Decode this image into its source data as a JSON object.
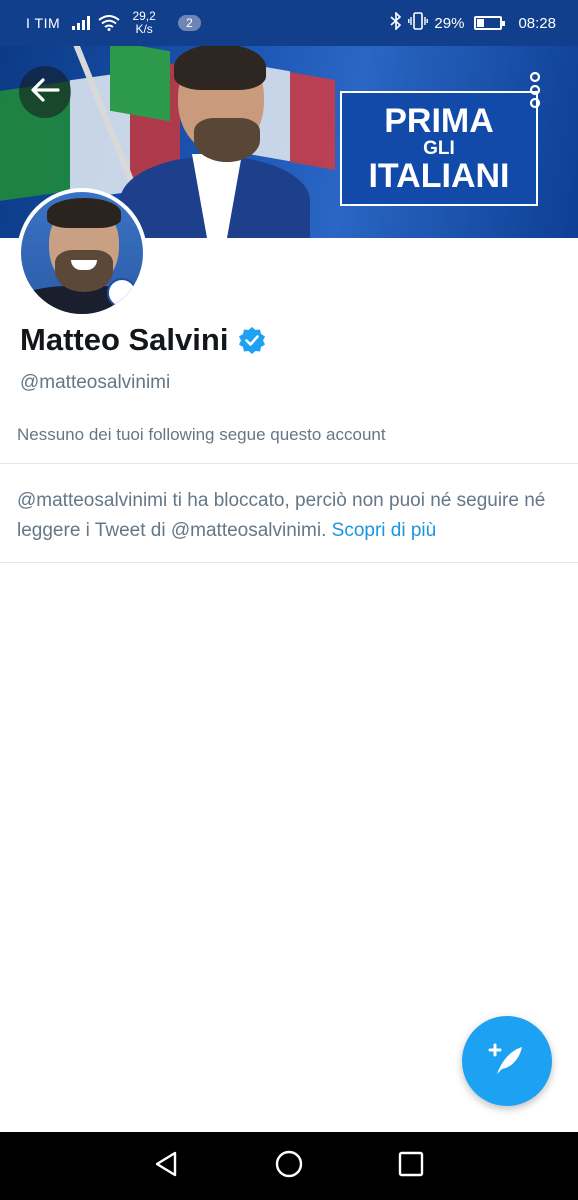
{
  "status_bar": {
    "carrier": "I TIM",
    "speed_value": "29,2",
    "speed_unit": "K/s",
    "notification_count": "2",
    "battery_percent": "29%",
    "battery_level": 0.29,
    "time": "08:28",
    "icons": [
      "signal-icon",
      "wifi-icon",
      "bluetooth-icon",
      "vibrate-icon",
      "battery-icon"
    ]
  },
  "banner": {
    "sign_line1": "PRIMA",
    "sign_line2": "GLI",
    "sign_line3": "ITALIANI",
    "back_icon": "arrow-left-icon",
    "more_icon": "more-vertical-icon"
  },
  "profile": {
    "name": "Matteo Salvini",
    "verified_icon": "verified-badge-icon",
    "handle": "@matteosalvinimi",
    "followers_note": "Nessuno dei tuoi following segue questo account",
    "blocked_text": "@matteosalvinimi ti ha bloccato, perciò non puoi né seguire né leggere i Tweet di @matteosalvinimi.",
    "learn_more": "Scopri di più"
  },
  "fab": {
    "icon": "compose-tweet-icon"
  },
  "nav": {
    "icons": [
      "back-triangle-icon",
      "home-circle-icon",
      "recents-square-icon"
    ]
  },
  "colors": {
    "status_bar": "#123f8c",
    "twitter_blue": "#1da1f2",
    "link_blue": "#1b95e0",
    "secondary_text": "#657786",
    "divider": "#e1e8ed"
  }
}
